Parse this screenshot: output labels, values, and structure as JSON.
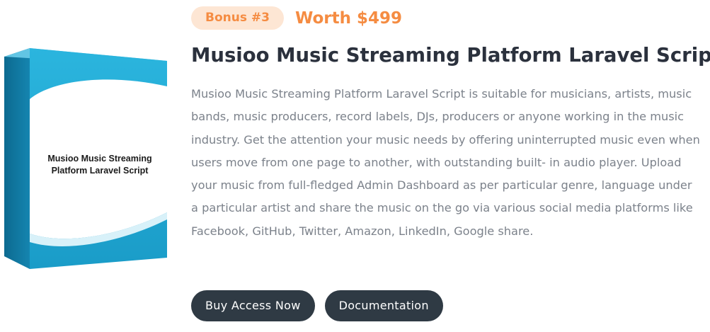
{
  "product": {
    "box_label_line1": "Musioo Music Streaming",
    "box_label_line2": "Platform Laravel Script",
    "colors": {
      "box_blue": "#1fa9d4",
      "box_blue_dark": "#0e6f96"
    }
  },
  "bonus": {
    "badge": "Bonus #3",
    "worth": "Worth $499",
    "accent": "#f58c42"
  },
  "title": "Musioo Music Streaming Platform Laravel Script",
  "description": "Musioo Music Streaming Platform Laravel Script is suitable for musicians, artists, music bands, music producers, record labels, DJs, producers or anyone working in the music industry. Get the attention your music needs by offering uninterrupted music even when users move from one page to another, with outstanding built- in audio player. Upload your music from full-fledged Admin Dashboard as per particular genre, language under a particular artist and share the music on the go via various social media platforms like Facebook, GitHub, Twitter, Amazon, LinkedIn, Google share.",
  "buttons": {
    "buy": "Buy Access Now",
    "docs": "Documentation"
  }
}
